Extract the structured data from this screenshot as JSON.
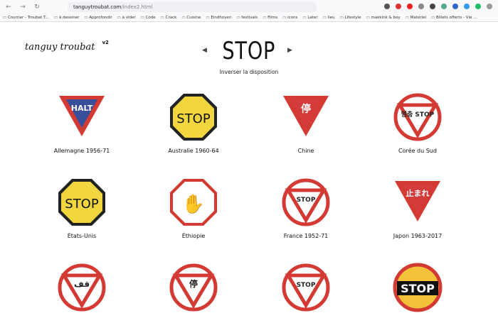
{
  "browser": {
    "url_host": "tanguytroubat.com",
    "url_path": "/index2.html",
    "bookmarks": [
      "Courrier - Troubat T...",
      "à dessiner",
      "Approfondir",
      "à vider",
      "Code",
      "Crack",
      "Cuisine",
      "Eindhoven",
      "festivals",
      "Films",
      "icons",
      "Later",
      "lieu",
      "Lifestyle",
      "makkink & bey",
      "Matériel",
      "Billets offerts - Vie ..."
    ]
  },
  "header": {
    "logo": "tanguy troubat",
    "version": "v2",
    "title": "STOP",
    "prev": "◀",
    "next": "▶",
    "subtitle": "Inverser la disposition"
  },
  "signs": [
    {
      "label": "Allemagne 1956-71",
      "shape": "triangle",
      "text": "HALT",
      "fill": "#3a4f9a"
    },
    {
      "label": "Australie 1960-64",
      "shape": "octagon",
      "text": "STOP",
      "fill": "#f2d640",
      "textfill": "#111"
    },
    {
      "label": "Chine",
      "shape": "triangle",
      "text": "停",
      "fill": "#d43b3b"
    },
    {
      "label": "Corée du Sud",
      "shape": "circle-tri",
      "text": "멈춤 STOP",
      "fill": "#fff"
    },
    {
      "label": "États-Unis",
      "shape": "octagon",
      "text": "STOP",
      "fill": "#f2d640",
      "textfill": "#111"
    },
    {
      "label": "Éthiopie",
      "shape": "octagon-hand",
      "text": "✋",
      "fill": "#fff"
    },
    {
      "label": "France 1952-71",
      "shape": "circle-tri",
      "text": "STOP",
      "fill": "#fff"
    },
    {
      "label": "Japon 1963-2017",
      "shape": "triangle",
      "text": "止まれ",
      "fill": "#d43b3b"
    },
    {
      "label": "",
      "shape": "circle-tri",
      "text": "قف",
      "fill": "#fff"
    },
    {
      "label": "",
      "shape": "circle-tri",
      "text": "停",
      "fill": "#fff"
    },
    {
      "label": "",
      "shape": "circle-tri",
      "text": "STOP",
      "fill": "#fff"
    },
    {
      "label": "",
      "shape": "circle-stop",
      "text": "STOP",
      "fill": "#f2c23a"
    }
  ]
}
